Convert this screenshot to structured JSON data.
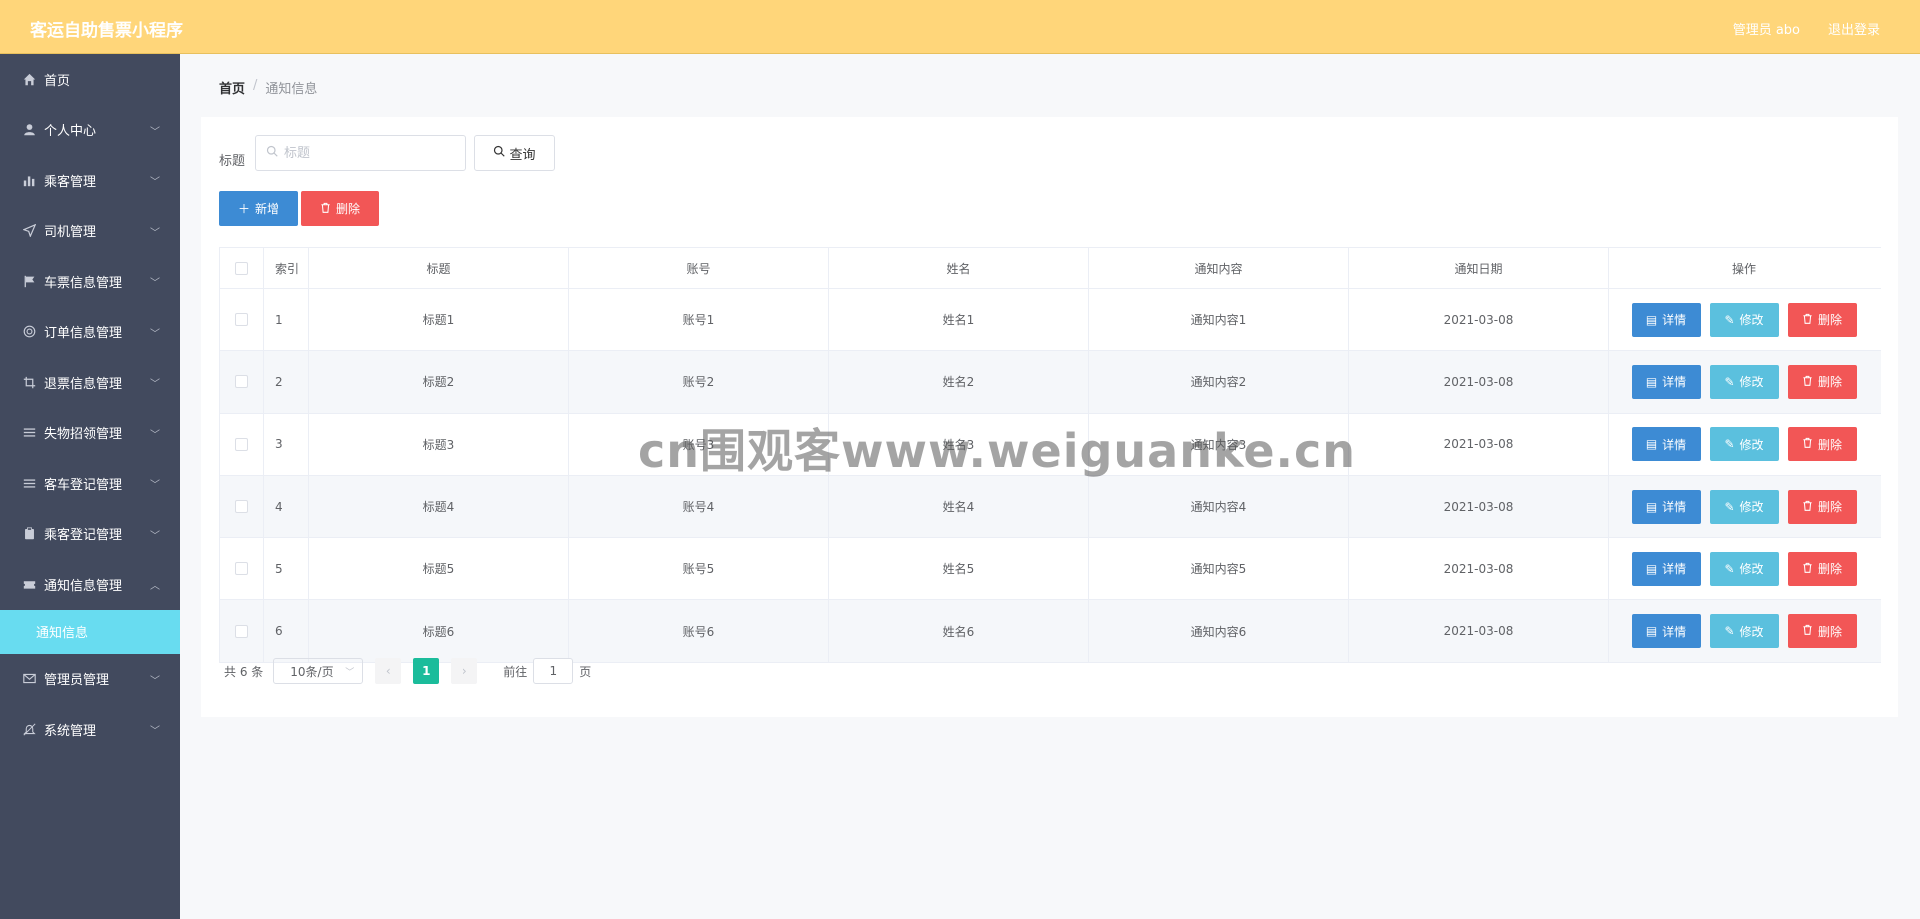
{
  "header": {
    "app_title": "客运自助售票小程序",
    "user": "管理员 abo",
    "logout": "退出登录"
  },
  "sidebar": {
    "items": [
      {
        "label": "首页",
        "icon": "home-icon"
      },
      {
        "label": "个人中心",
        "icon": "user-icon"
      },
      {
        "label": "乘客管理",
        "icon": "bar-chart-icon"
      },
      {
        "label": "司机管理",
        "icon": "send-icon"
      },
      {
        "label": "车票信息管理",
        "icon": "flag-icon"
      },
      {
        "label": "订单信息管理",
        "icon": "globe-icon"
      },
      {
        "label": "退票信息管理",
        "icon": "crop-icon"
      },
      {
        "label": "失物招领管理",
        "icon": "list-icon"
      },
      {
        "label": "客车登记管理",
        "icon": "list-icon"
      },
      {
        "label": "乘客登记管理",
        "icon": "clipboard-icon"
      },
      {
        "label": "通知信息管理",
        "icon": "ticket-icon"
      },
      {
        "label": "管理员管理",
        "icon": "mail-icon"
      },
      {
        "label": "系统管理",
        "icon": "bell-off-icon"
      }
    ],
    "active_sub": "通知信息"
  },
  "breadcrumb": {
    "home": "首页",
    "separator": "/",
    "current": "通知信息"
  },
  "search": {
    "label": "标题",
    "placeholder": "标题",
    "query_button": "查询"
  },
  "actions": {
    "add": "新增",
    "delete": "删除"
  },
  "table": {
    "columns": [
      "索引",
      "标题",
      "账号",
      "姓名",
      "通知内容",
      "通知日期",
      "操作"
    ],
    "rows": [
      {
        "index": "1",
        "title": "标题1",
        "account": "账号1",
        "name": "姓名1",
        "content": "通知内容1",
        "date": "2021-03-08"
      },
      {
        "index": "2",
        "title": "标题2",
        "account": "账号2",
        "name": "姓名2",
        "content": "通知内容2",
        "date": "2021-03-08"
      },
      {
        "index": "3",
        "title": "标题3",
        "account": "账号3",
        "name": "姓名3",
        "content": "通知内容3",
        "date": "2021-03-08"
      },
      {
        "index": "4",
        "title": "标题4",
        "account": "账号4",
        "name": "姓名4",
        "content": "通知内容4",
        "date": "2021-03-08"
      },
      {
        "index": "5",
        "title": "标题5",
        "account": "账号5",
        "name": "姓名5",
        "content": "通知内容5",
        "date": "2021-03-08"
      },
      {
        "index": "6",
        "title": "标题6",
        "account": "账号6",
        "name": "姓名6",
        "content": "通知内容6",
        "date": "2021-03-08"
      }
    ],
    "row_actions": {
      "detail": "详情",
      "edit": "修改",
      "remove": "删除"
    }
  },
  "pagination": {
    "total": "共 6 条",
    "page_size": "10条/页",
    "current_page": "1",
    "goto_prefix": "前往",
    "goto_value": "1",
    "goto_suffix": "页"
  },
  "watermark": "cn围观客www.weiguanke.cn",
  "colors": {
    "header": "#ffd67a",
    "sidebar": "#424a5e",
    "active_sub": "#68dcf0",
    "primary": "#3d8bd4",
    "info": "#5bc0de",
    "danger": "#f25656",
    "page_active": "#1bbc9b"
  }
}
